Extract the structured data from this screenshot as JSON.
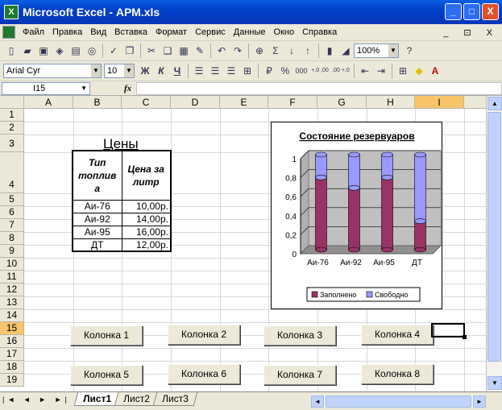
{
  "window": {
    "title": "Microsoft Excel - АРМ.xls",
    "minimize": "_",
    "maximize": "□",
    "close": "X"
  },
  "menu": [
    "Файл",
    "Правка",
    "Вид",
    "Вставка",
    "Формат",
    "Сервис",
    "Данные",
    "Окно",
    "Справка"
  ],
  "doc_controls": "_ ⊡ X",
  "toolbar": {
    "zoom": "100%",
    "font": "Arial Cyr",
    "size": "10",
    "bold": "Ж",
    "italic": "К",
    "underline": "Ч",
    "percent": "%",
    "thousands": "000",
    "inc_dec": "+,0 ,00",
    "dec_dec": ",00 +,0"
  },
  "formula_bar": {
    "name_box": "I15",
    "fx": "fx",
    "value": ""
  },
  "columns": [
    "A",
    "B",
    "C",
    "D",
    "E",
    "F",
    "G",
    "H",
    "I"
  ],
  "selected_column": "I",
  "rows": [
    "1",
    "2",
    "3",
    "4",
    "5",
    "6",
    "7",
    "8",
    "9",
    "10",
    "11",
    "12",
    "13",
    "14",
    "15",
    "16",
    "17",
    "18",
    "19"
  ],
  "selected_row": "15",
  "prices": {
    "title": "Цены",
    "header": [
      "Тип топлив а",
      "Цена за литр"
    ],
    "rows": [
      [
        "Аи-76",
        "10,00р."
      ],
      [
        "Аи-92",
        "14,00р."
      ],
      [
        "Аи-95",
        "16,00р."
      ],
      [
        "ДТ",
        "12,00р."
      ]
    ]
  },
  "chart_data": {
    "type": "bar",
    "stacked": true,
    "title": "Состояние резервуаров",
    "categories": [
      "Аи-76",
      "Аи-92",
      "Аи-95",
      "ДТ"
    ],
    "series": [
      {
        "name": "Заполнено",
        "values": [
          0.76,
          0.65,
          0.76,
          0.3
        ],
        "color": "#993366"
      },
      {
        "name": "Свободно",
        "values": [
          0.24,
          0.35,
          0.24,
          0.7
        ],
        "color": "#9999ff"
      }
    ],
    "ylim": [
      0,
      1
    ],
    "yticks": [
      "0",
      "0,2",
      "0,4",
      "0,6",
      "0,8",
      "1"
    ],
    "legend": "bottom",
    "grid": true
  },
  "buttons": [
    "Колонка 1",
    "Колонка 2",
    "Колонка 3",
    "Колонка 4",
    "Колонка 5",
    "Колонка 6",
    "Колонка 7",
    "Колонка 8"
  ],
  "sheet_tabs": [
    "Лист1",
    "Лист2",
    "Лист3"
  ],
  "active_sheet": "Лист1",
  "tab_nav": "|◄ ◄ ► ►|"
}
